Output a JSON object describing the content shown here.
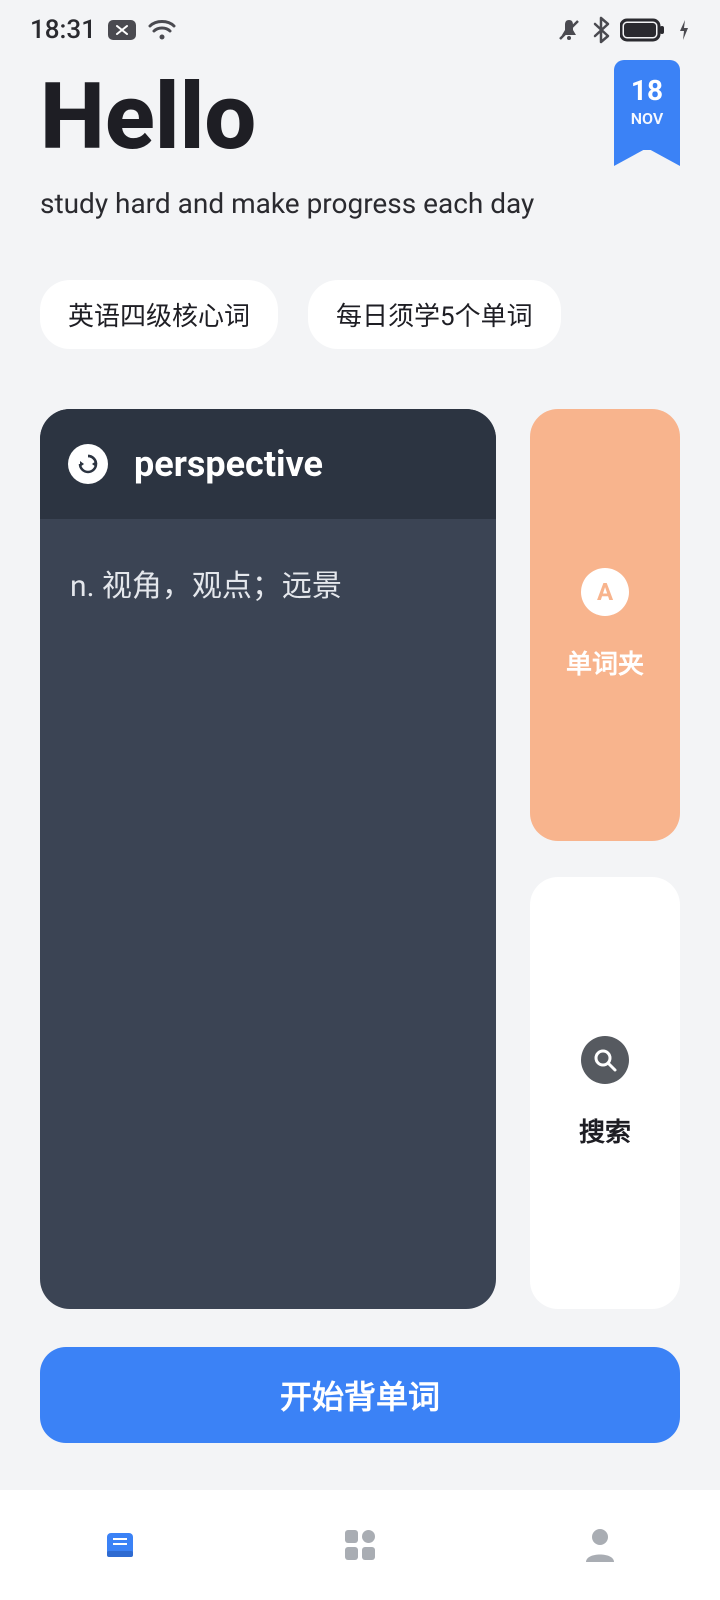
{
  "status": {
    "time": "18:31"
  },
  "header": {
    "greeting": "Hello",
    "subtitle": "study hard and make progress each day",
    "date_day": "18",
    "date_month": "NOV"
  },
  "chips": [
    "英语四级核心词",
    "每日须学5个单词"
  ],
  "word_card": {
    "word": "perspective",
    "definition": "n. 视角，观点；远景"
  },
  "side": {
    "favorites_label": "单词夹",
    "favorites_icon_letter": "A",
    "search_label": "搜索"
  },
  "cta": {
    "label": "开始背单词"
  },
  "colors": {
    "accent": "#3b82f6",
    "card_dark": "#3b4454",
    "card_dark_header": "#2c3441",
    "peach": "#f8b48d"
  }
}
